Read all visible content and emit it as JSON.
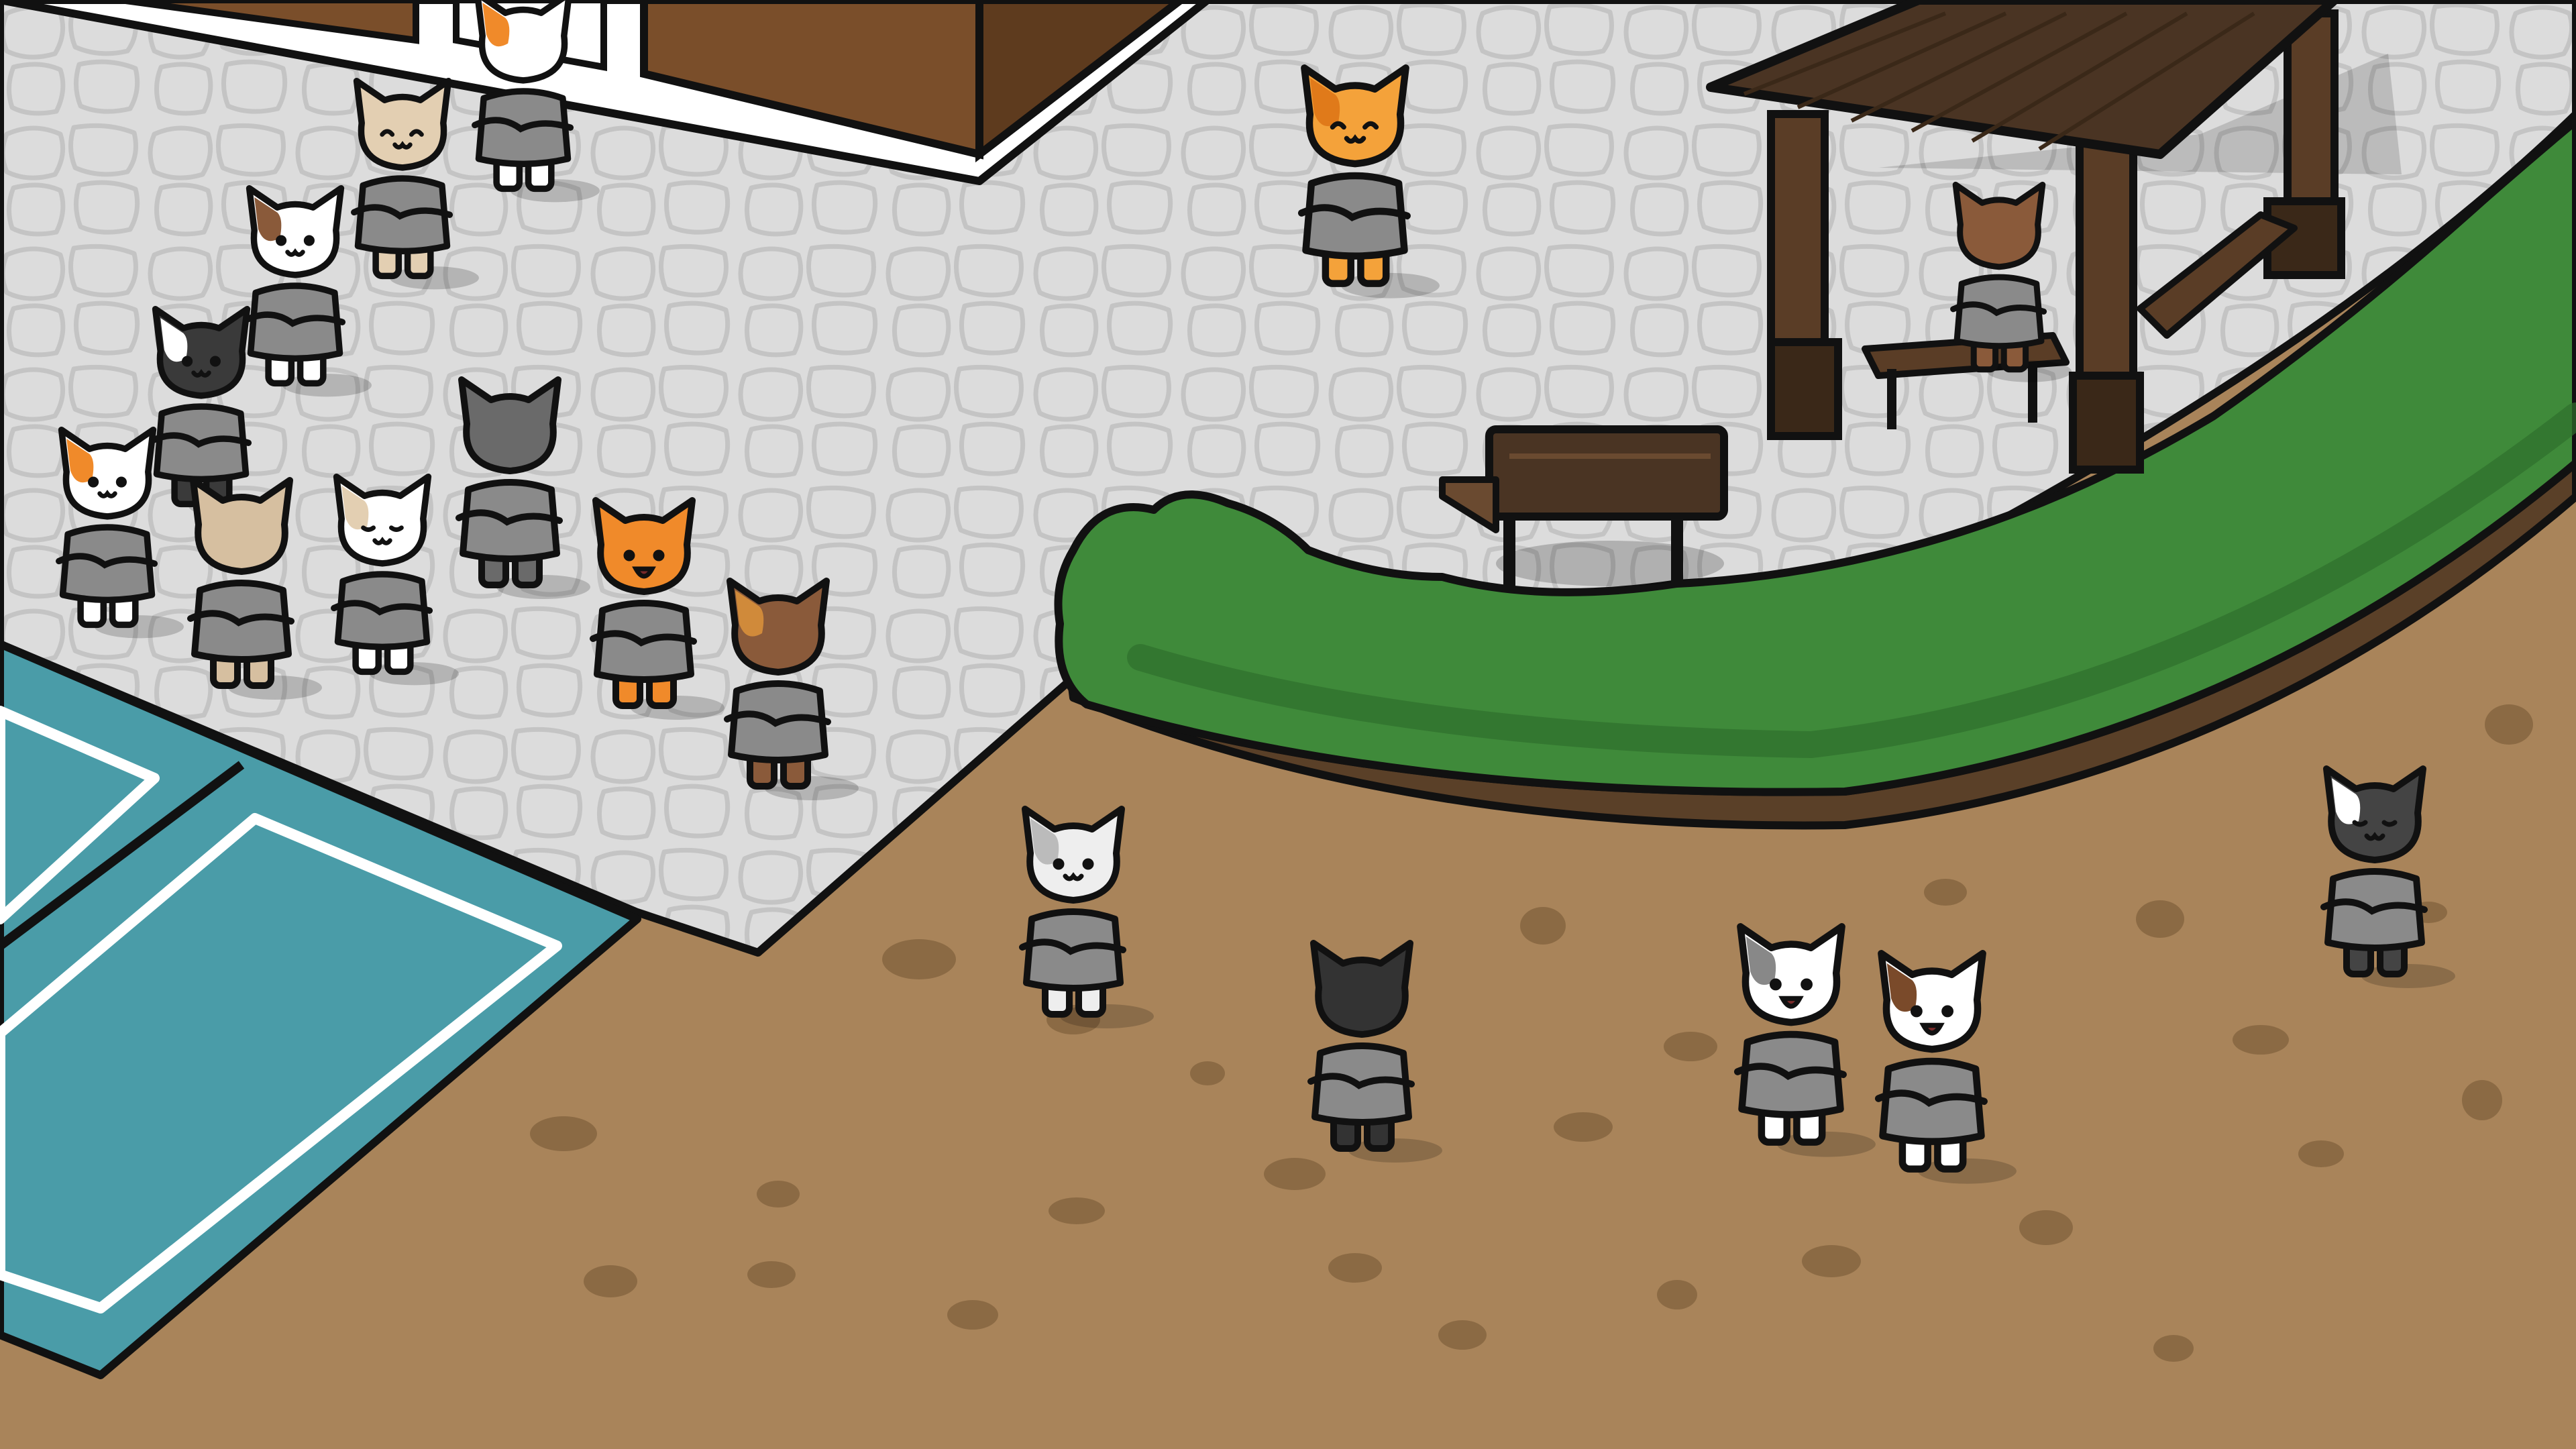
{
  "scene": {
    "kind": "isometric courtyard game scene",
    "text": []
  },
  "palette": {
    "outline": "#111111",
    "dirt": "#a9845a",
    "dirt_spot": "#8b6a44",
    "pavement": "#dcdcdc",
    "pavement_lines": "#c4c4c4",
    "pool_water": "#4a9ca8",
    "pool_line": "#ffffff",
    "hedge": "#3f8a3a",
    "hedge_dark": "#2f6f2c",
    "planter_edge": "#5a4028",
    "wood": "#4a3423",
    "wood_light": "#6a4a30",
    "brick": "#7a4e2a",
    "uniform": "#8a8a8a",
    "shadow": "#5a5a5a"
  },
  "cats": [
    {
      "id": "cat-white-orange-top",
      "fur": "#ffffff",
      "patch": "#f08a2a",
      "face": "back"
    },
    {
      "id": "cat-beige-line-1",
      "fur": "#e3cfb2",
      "patch": "",
      "face": "smile"
    },
    {
      "id": "cat-brown-white-line-2",
      "fur": "#ffffff",
      "patch": "#8a5a3a",
      "face": "front"
    },
    {
      "id": "cat-black-white-line-3",
      "fur": "#3a3a3a",
      "patch": "#ffffff",
      "face": "front"
    },
    {
      "id": "cat-calico-line-4",
      "fur": "#ffffff",
      "patch": "#f08a2a",
      "face": "front"
    },
    {
      "id": "cat-grey-tabby",
      "fur": "#6a6a6a",
      "patch": "",
      "face": "back"
    },
    {
      "id": "cat-beige-back",
      "fur": "#d6bfa0",
      "patch": "",
      "face": "back"
    },
    {
      "id": "cat-white-sleepy",
      "fur": "#ffffff",
      "patch": "#e3cfb2",
      "face": "sleepy"
    },
    {
      "id": "cat-orange-happy",
      "fur": "#f08a2a",
      "patch": "",
      "face": "open"
    },
    {
      "id": "cat-tortie-back",
      "fur": "#8a5a3a",
      "patch": "#d08a3a",
      "face": "back"
    },
    {
      "id": "cat-orange-tabby-smile",
      "fur": "#f4a23a",
      "patch": "#e07a1a",
      "face": "smile"
    },
    {
      "id": "cat-brown-gazebo",
      "fur": "#8a5a3a",
      "patch": "",
      "face": "back"
    },
    {
      "id": "cat-white-grey-dirt",
      "fur": "#eeeeee",
      "patch": "#bbbbbb",
      "face": "front"
    },
    {
      "id": "cat-black-dirt",
      "fur": "#333333",
      "patch": "",
      "face": "back"
    },
    {
      "id": "cat-white-singing",
      "fur": "#ffffff",
      "patch": "#888888",
      "face": "open"
    },
    {
      "id": "cat-brown-white-talking",
      "fur": "#ffffff",
      "patch": "#7a4a2a",
      "face": "open"
    },
    {
      "id": "cat-black-white-right",
      "fur": "#444444",
      "patch": "#ffffff",
      "face": "sleepy"
    }
  ]
}
